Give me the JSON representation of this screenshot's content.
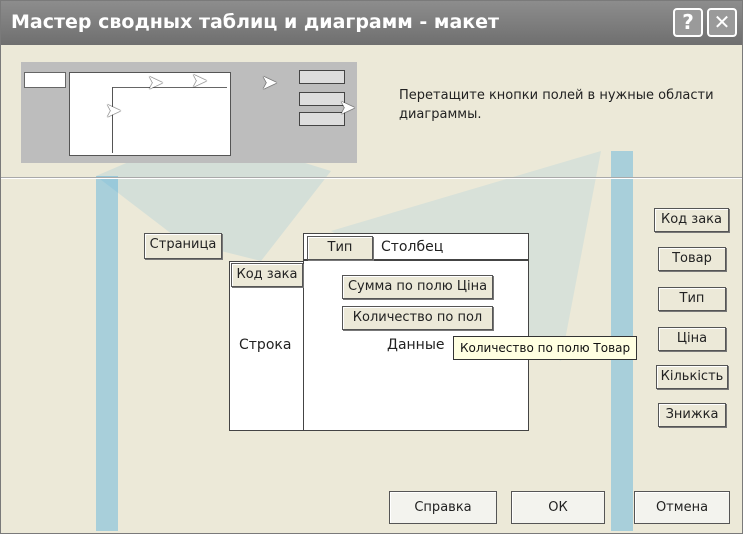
{
  "window": {
    "title": "Мастер сводных таблиц и диаграмм - макет",
    "help_glyph": "?",
    "close_glyph": "✕"
  },
  "instruction": "Перетащите кнопки полей в нужные области диаграммы.",
  "layout_areas": {
    "page": "Страница",
    "column": "Столбец",
    "row": "Строка",
    "data": "Данные"
  },
  "placed_fields": {
    "column": "Тип",
    "row": "Код зака",
    "data": [
      "Сумма по полю Ціна",
      "Количество по пол"
    ]
  },
  "available_fields": [
    "Код зака",
    "Товар",
    "Тип",
    "Ціна",
    "Кількість",
    "Знижка"
  ],
  "tooltip": "Количество по полю Товар",
  "buttons": {
    "help": "Справка",
    "ok": "ОК",
    "cancel": "Отмена"
  },
  "colors": {
    "titlebar": "#7c7c7c",
    "dialog_bg": "#ece9d8",
    "watermark": "#2aa0e0",
    "tooltip_bg": "#ffffe1"
  }
}
